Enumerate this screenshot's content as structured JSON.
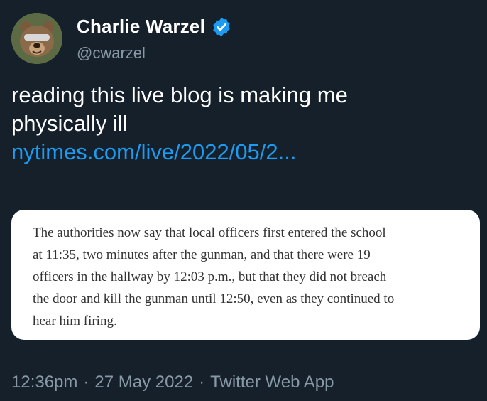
{
  "author": {
    "display_name": "Charlie Warzel",
    "handle": "@cwarzel",
    "verified_icon": "verified-badge-icon",
    "avatar_icon": "bear-avatar"
  },
  "tweet": {
    "text_lines": [
      "reading this live blog is making me",
      "physically ill"
    ],
    "link_text": "nytimes.com/live/2022/05/2..."
  },
  "quote_image": {
    "lines": [
      "The authorities now say that local officers first entered the school",
      "at 11:35, two minutes after the gunman, and that there were 19",
      "officers in the hallway by 12:03 p.m., but that they did not breach",
      "the door and kill the gunman until 12:50, even as they continued to",
      "hear him firing."
    ]
  },
  "meta": {
    "time": "12:36pm",
    "separator": "·",
    "date": "27 May 2022",
    "source": "Twitter Web App"
  },
  "colors": {
    "background": "#15202b",
    "link": "#1d9bf0",
    "secondary_text": "#8899a6",
    "verified": "#1d9bf0"
  }
}
